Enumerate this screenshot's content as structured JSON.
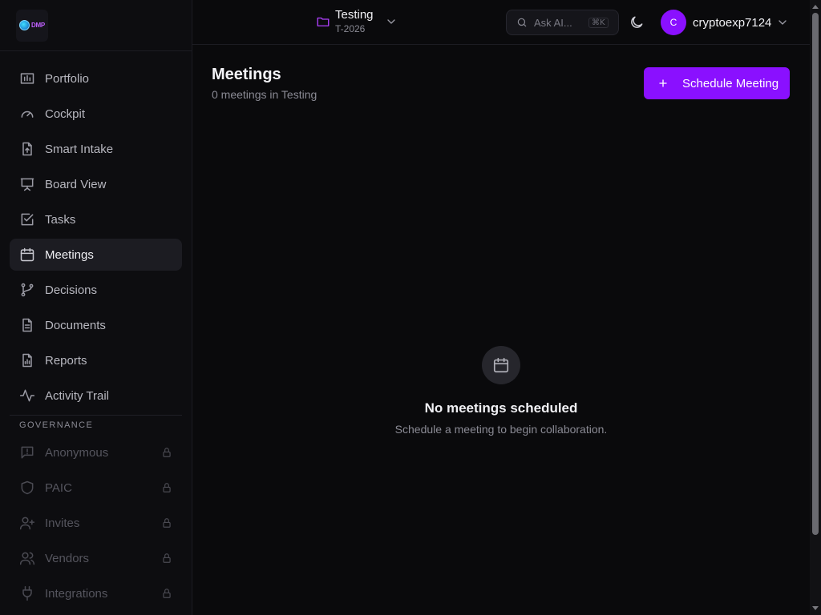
{
  "brand": {
    "logo_text": "DMP"
  },
  "sidebar": {
    "items": [
      {
        "label": "Portfolio",
        "icon": "portfolio-icon"
      },
      {
        "label": "Cockpit",
        "icon": "gauge-icon"
      },
      {
        "label": "Smart Intake",
        "icon": "file-upload-icon"
      },
      {
        "label": "Board View",
        "icon": "presentation-icon"
      },
      {
        "label": "Tasks",
        "icon": "checkbox-icon"
      },
      {
        "label": "Meetings",
        "icon": "calendar-icon",
        "active": true
      },
      {
        "label": "Decisions",
        "icon": "git-branch-icon"
      },
      {
        "label": "Documents",
        "icon": "document-icon"
      },
      {
        "label": "Reports",
        "icon": "report-icon"
      },
      {
        "label": "Activity Trail",
        "icon": "activity-icon"
      }
    ],
    "governance_heading": "GOVERNANCE",
    "governance_items": [
      {
        "label": "Anonymous",
        "icon": "message-alert-icon",
        "locked": true
      },
      {
        "label": "PAIC",
        "icon": "shield-icon",
        "locked": true
      },
      {
        "label": "Invites",
        "icon": "user-plus-icon",
        "locked": true
      },
      {
        "label": "Vendors",
        "icon": "users-icon",
        "locked": true
      },
      {
        "label": "Integrations",
        "icon": "plug-icon",
        "locked": true
      }
    ]
  },
  "header": {
    "project_name": "Testing",
    "project_code": "T-2026",
    "search_placeholder": "Ask AI...",
    "search_shortcut": "⌘K",
    "user_initial": "C",
    "username": "cryptoexp7124"
  },
  "main": {
    "title": "Meetings",
    "subtitle": "0 meetings in Testing",
    "schedule_button": "Schedule Meeting",
    "empty_title": "No meetings scheduled",
    "empty_subtitle": "Schedule a meeting to begin collaboration."
  },
  "colors": {
    "accent": "#8a10ff",
    "background": "#0a0a0c",
    "sidebar": "#0d0d10"
  }
}
